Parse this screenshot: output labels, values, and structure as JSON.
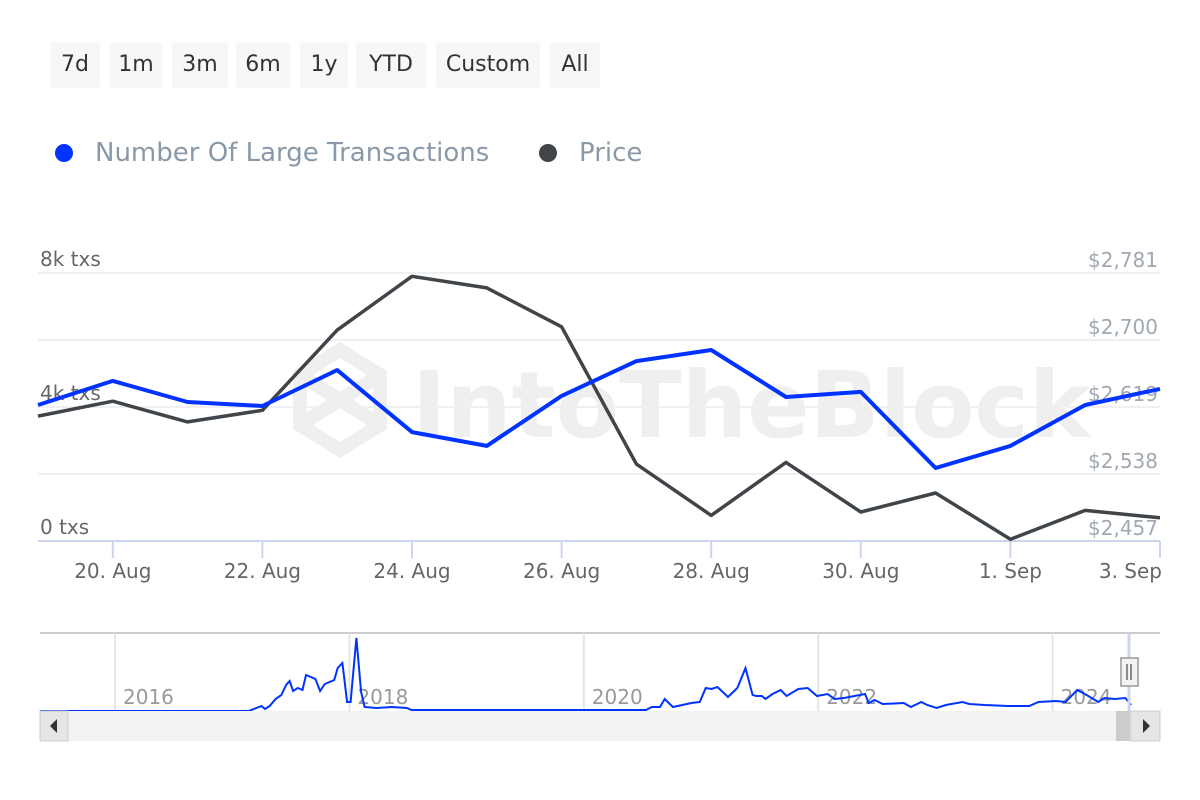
{
  "range_buttons": [
    "7d",
    "1m",
    "3m",
    "6m",
    "1y",
    "YTD",
    "Custom",
    "All"
  ],
  "legend": [
    {
      "label": "Number Of Large Transactions",
      "color": "#0033ff"
    },
    {
      "label": "Price",
      "color": "#40454a"
    }
  ],
  "watermark": "IntoTheBlock",
  "chart_data": {
    "type": "line",
    "x": [
      "19 Aug",
      "20 Aug",
      "21 Aug",
      "22 Aug",
      "23 Aug",
      "24 Aug",
      "25 Aug",
      "26 Aug",
      "27 Aug",
      "28 Aug",
      "29 Aug",
      "30 Aug",
      "31 Aug",
      "1 Sep",
      "2 Sep",
      "3 Sep"
    ],
    "x_tick_labels": [
      "20. Aug",
      "22. Aug",
      "24. Aug",
      "26. Aug",
      "28. Aug",
      "30. Aug",
      "1. Sep",
      "3. Sep"
    ],
    "series": [
      {
        "name": "Number Of Large Transactions",
        "axis": "left",
        "color": "#0033ff",
        "values": [
          4060,
          4780,
          4150,
          4030,
          5100,
          3250,
          2840,
          4330,
          5370,
          5700,
          4300,
          4450,
          2180,
          2840,
          4060,
          4540
        ]
      },
      {
        "name": "Price",
        "axis": "right",
        "color": "#40454a",
        "values": [
          2608,
          2626,
          2601,
          2615,
          2712,
          2777,
          2763,
          2716,
          2550,
          2488,
          2552,
          2492,
          2515,
          2459,
          2494,
          2485
        ]
      }
    ],
    "y_left": {
      "ticks": [
        "0 txs",
        "4k txs",
        "8k txs"
      ],
      "range": [
        0,
        8000
      ]
    },
    "y_right": {
      "ticks": [
        "$2,457",
        "$2,538",
        "$2,619",
        "$2,700",
        "$2,781"
      ],
      "range": [
        2457,
        2781
      ]
    },
    "grid": true,
    "legend_position": "top-left",
    "navigator": {
      "year_labels": [
        "2016",
        "2018",
        "2020",
        "2022",
        "2024"
      ],
      "years": [
        2016,
        2018,
        2020,
        2022,
        2024
      ],
      "x": [
        2015.6,
        2017.14,
        2017.25,
        2017.28,
        2017.32,
        2017.37,
        2017.42,
        2017.46,
        2017.49,
        2017.52,
        2017.56,
        2017.6,
        2017.63,
        2017.71,
        2017.75,
        2017.79,
        2017.87,
        2017.9,
        2017.94,
        2017.98,
        2018.01,
        2018.06,
        2018.1,
        2018.13,
        2018.23,
        2018.36,
        2018.49,
        2018.53,
        2020.14,
        2020.53,
        2020.58,
        2020.65,
        2020.69,
        2020.76,
        2020.92,
        2020.99,
        2021.04,
        2021.09,
        2021.14,
        2021.23,
        2021.31,
        2021.38,
        2021.44,
        2021.47,
        2021.52,
        2021.55,
        2021.61,
        2021.68,
        2021.73,
        2021.83,
        2021.91,
        2021.99,
        2022.08,
        2022.14,
        2022.22,
        2022.31,
        2022.4,
        2022.43,
        2022.48,
        2022.55,
        2022.73,
        2022.79,
        2022.88,
        2022.93,
        2023.01,
        2023.09,
        2023.23,
        2023.29,
        2023.42,
        2023.62,
        2023.8,
        2023.88,
        2024.03,
        2024.11,
        2024.21,
        2024.29,
        2024.39,
        2024.44,
        2024.53,
        2024.62,
        2024.67
      ],
      "values": [
        0,
        0,
        3500,
        1400,
        3500,
        8400,
        11200,
        18200,
        21000,
        14000,
        16100,
        14700,
        25200,
        22400,
        14000,
        18900,
        21700,
        30100,
        33600,
        6300,
        6300,
        51100,
        13300,
        2800,
        2100,
        2800,
        2100,
        700,
        700,
        700,
        2800,
        2800,
        8400,
        2800,
        5600,
        6300,
        16100,
        15400,
        16800,
        9800,
        16100,
        30100,
        11200,
        10500,
        10500,
        8400,
        11900,
        14700,
        10500,
        15400,
        16100,
        10500,
        11900,
        8400,
        9100,
        10500,
        11900,
        5600,
        7700,
        4900,
        5600,
        2800,
        6300,
        4200,
        2100,
        4200,
        6300,
        4900,
        4200,
        3500,
        3500,
        6300,
        7000,
        6300,
        14700,
        11200,
        6300,
        9100,
        8400,
        9100,
        4200
      ]
    }
  }
}
